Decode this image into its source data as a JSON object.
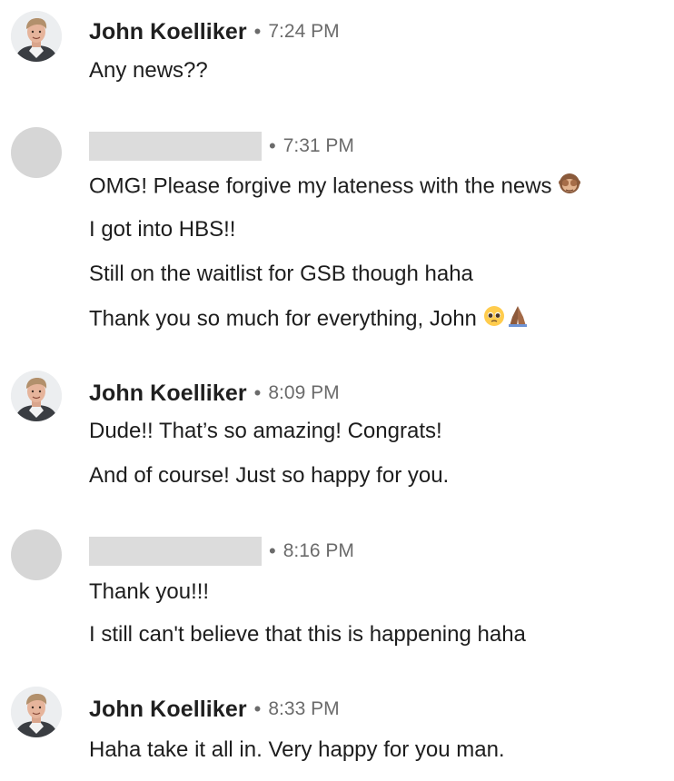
{
  "messages": [
    {
      "sender": "John Koelliker",
      "time": "7:24 PM",
      "lines": [
        "Any news??"
      ]
    },
    {
      "sender": "",
      "time": "7:31 PM",
      "lines": [
        "OMG! Please forgive my lateness with the news",
        "I got into HBS!!",
        "Still on the waitlist for GSB though haha",
        "Thank you so much for everything, John"
      ]
    },
    {
      "sender": "John Koelliker",
      "time": "8:09 PM",
      "lines": [
        "Dude!! That’s so amazing! Congrats!",
        "And of course! Just so happy for you."
      ]
    },
    {
      "sender": "",
      "time": "8:16 PM",
      "lines": [
        "Thank you!!!",
        "I still can't believe that this is happening haha"
      ]
    },
    {
      "sender": "John Koelliker",
      "time": "8:33 PM",
      "lines": [
        "Haha take it all in. Very happy for you man."
      ]
    }
  ],
  "separator": "•",
  "icons": {
    "see_no_evil": "see-no-evil-monkey-icon",
    "pleading_face": "pleading-face-icon",
    "folded_hands": "folded-hands-icon"
  },
  "colors": {
    "text": "#1d1d1d",
    "meta": "#6b6b6b",
    "redaction": "#dcdcdc",
    "avatar_placeholder": "#d6d6d6"
  }
}
